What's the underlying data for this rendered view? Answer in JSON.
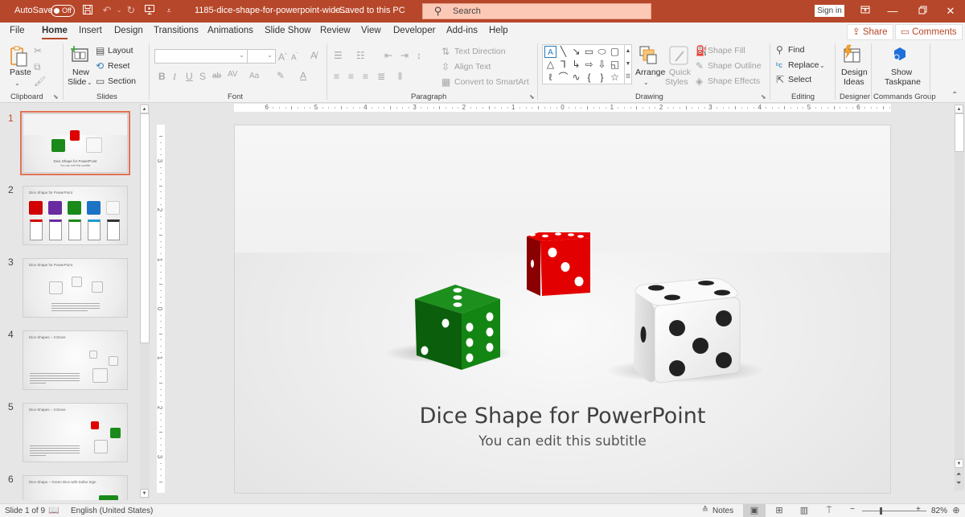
{
  "titlebar": {
    "autosave_label": "AutoSave",
    "autosave_state": "Off",
    "doc_title": "1185-dice-shape-for-powerpoint-wide....",
    "save_status": "-  Saved to this PC",
    "search_placeholder": "Search",
    "signin_label": "Sign in",
    "accent_color": "#b7472a"
  },
  "tabs": [
    "File",
    "Home",
    "Insert",
    "Design",
    "Transitions",
    "Animations",
    "Slide Show",
    "Review",
    "View",
    "Developer",
    "Add-ins",
    "Help"
  ],
  "active_tab": "Home",
  "share_label": "Share",
  "comments_label": "Comments",
  "ribbon": {
    "clipboard": {
      "paste": "Paste",
      "label": "Clipboard"
    },
    "slides": {
      "new_slide_1": "New",
      "new_slide_2": "Slide",
      "layout": "Layout",
      "reset": "Reset",
      "section": "Section",
      "label": "Slides"
    },
    "font": {
      "font_name": "",
      "font_size": "",
      "label": "Font"
    },
    "paragraph": {
      "text_direction": "Text Direction",
      "align_text": "Align Text",
      "convert_smartart": "Convert to SmartArt",
      "label": "Paragraph"
    },
    "drawing": {
      "arrange": "Arrange",
      "quick_styles_1": "Quick",
      "quick_styles_2": "Styles",
      "shape_fill": "Shape Fill",
      "shape_outline": "Shape Outline",
      "shape_effects": "Shape Effects",
      "label": "Drawing"
    },
    "editing": {
      "find": "Find",
      "replace": "Replace",
      "select": "Select",
      "label": "Editing"
    },
    "designer": {
      "design_ideas_1": "Design",
      "design_ideas_2": "Ideas",
      "label": "Designer"
    },
    "commands": {
      "show_taskpane_1": "Show",
      "show_taskpane_2": "Taskpane",
      "label": "Commands Group"
    }
  },
  "thumbnails": [
    {
      "number": "1",
      "title": "Dice Shape for PowerPoint",
      "subtitle": "You can edit this subtitle",
      "active": true
    },
    {
      "number": "2",
      "title": "Dice Shape for PowerPoint",
      "active": false
    },
    {
      "number": "3",
      "title": "Dice Shape for PowerPoint",
      "active": false
    },
    {
      "number": "4",
      "title": "Dice Shapes – 3 Dices",
      "active": false
    },
    {
      "number": "5",
      "title": "Dice Shapes – 3 Dices",
      "active": false
    },
    {
      "number": "6",
      "title": "Dice Shape – Green Dice with Dollar Sign",
      "active": false
    }
  ],
  "ruler": {
    "horizontal": [
      "6",
      "5",
      "4",
      "3",
      "2",
      "1",
      "0",
      "1",
      "2",
      "3",
      "4",
      "5",
      "6"
    ],
    "vertical": [
      "3",
      "2",
      "1",
      "0",
      "1",
      "2",
      "3"
    ]
  },
  "slide": {
    "title": "Dice Shape for PowerPoint",
    "subtitle": "You can edit this subtitle",
    "dice": [
      {
        "name": "green-die",
        "color": "#1a8a1a",
        "pips": "white",
        "top_face": 3,
        "front_face": 2,
        "side_face": 6
      },
      {
        "name": "red-die",
        "color": "#e00000",
        "pips": "white",
        "top_face": 5,
        "front_face": 1,
        "side_face": 3
      },
      {
        "name": "white-die",
        "color": "#f4f4f4",
        "pips": "black",
        "top_face": 4,
        "front_face": 1,
        "side_face": 5
      }
    ]
  },
  "statusbar": {
    "slide_info": "Slide 1 of 9",
    "language": "English (United States)",
    "notes_label": "Notes",
    "zoom_level": "82%",
    "zoom_percent": 82
  }
}
